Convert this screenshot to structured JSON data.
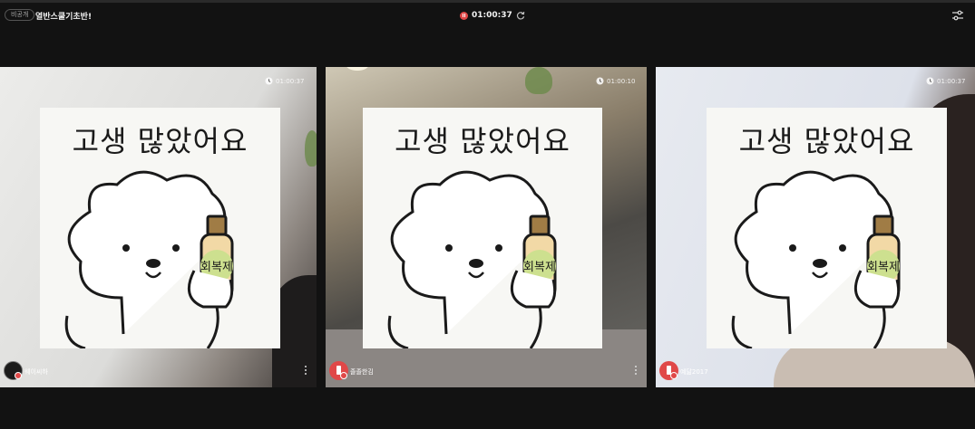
{
  "header": {
    "privacy_badge": "비공개",
    "room_title": "열반스쿨기초반!",
    "elapsed_time": "01:00:37"
  },
  "sticker": {
    "caption": "고생 많았어요",
    "bottle_label": "회복제"
  },
  "tiles": [
    {
      "timer": "01:00:37",
      "user_name": "웨이씨하"
    },
    {
      "timer": "01:00:10",
      "user_name": "졸졸한김"
    },
    {
      "timer": "01:00:37",
      "user_name": "예닮2017"
    }
  ],
  "icons": {
    "record": "record-pause-icon",
    "refresh": "refresh-icon",
    "settings": "sliders-icon",
    "clock": "clock-icon",
    "more": "more-vertical-icon"
  },
  "colors": {
    "background": "#121212",
    "record_red": "#e04848",
    "sticker_bg": "#f7f7f4",
    "bottle_body": "#f2d9a6",
    "bottle_label": "#cde08f"
  }
}
